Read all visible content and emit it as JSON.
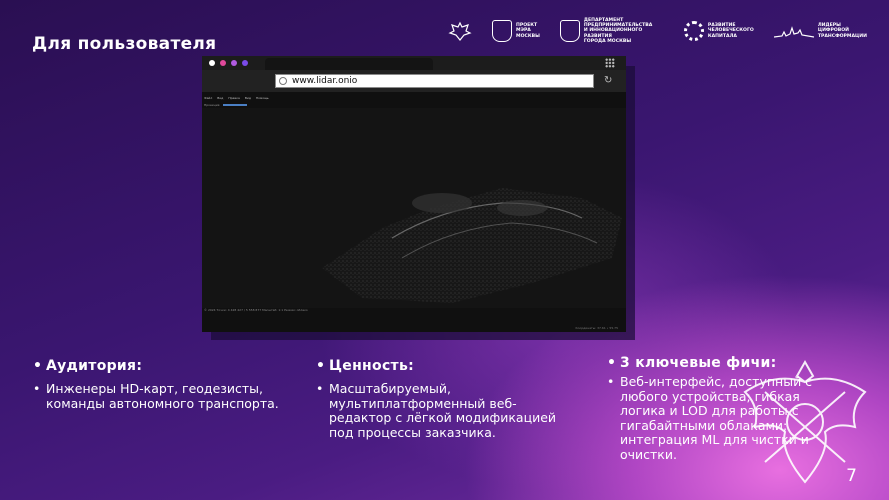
{
  "page": {
    "title": "Для пользователя",
    "page_number": "7"
  },
  "logos": [
    {
      "name": "eagle-emblem",
      "text": ""
    },
    {
      "name": "project-logo",
      "text": "ПРОЕКТ\nМЭРА\nМОСКВЫ"
    },
    {
      "name": "department-logo",
      "text": "ДЕПАРТАМЕНТ\nПРЕДПРИНИМАТЕЛЬСТВА\nИ ИННОВАЦИОННОГО РАЗВИТИЯ\nГОРОДА МОСКВЫ"
    },
    {
      "name": "human-capital-logo",
      "text": "РАЗВИТИЕ\nЧЕЛОВЕЧЕСКОГО\nКАПИТАЛА"
    },
    {
      "name": "digital-leaders-logo",
      "text": "ЛИДЕРЫ\nЦИФРОВОЙ\nТРАНСФОРМАЦИИ"
    }
  ],
  "browser": {
    "url": "www.lidar.onio",
    "dot_colors": [
      "#ffffff",
      "#e0489a",
      "#b05ae0",
      "#7a4ae8"
    ],
    "app_menu": [
      "Файл",
      "Вид",
      "Правка",
      "Вид",
      "Помощь"
    ],
    "app_toolbar_label": "Проекция",
    "status_text": "© 2024    Точки: 4 428 427 / 5 558 877    Масштаб: 1:1    Режим: облако",
    "bottom_text": "Координаты: 37.61 • 55.75"
  },
  "columns": [
    {
      "heading": "Аудитория:",
      "body": "Инженеры HD-карт, геодезисты, команды автономного транспорта."
    },
    {
      "heading": "Ценность:",
      "body": "Масштабируемый, мультиплатформенный веб-редактор с лёгкой модификацией под процессы заказчика."
    },
    {
      "heading": "3 ключевые фичи:",
      "body": "Веб-интерфейс, доступный с любого устройства; гибкая логика и LOD для работы с гигабайтными облаками; интеграция ML для чистки и очистки."
    }
  ]
}
